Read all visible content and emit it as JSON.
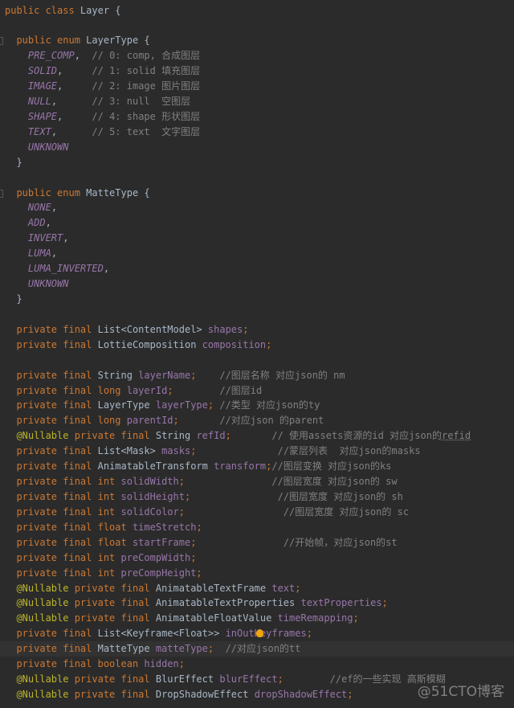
{
  "colors": {
    "background": "#2b2b2b",
    "keyword": "#cc7832",
    "type": "#a9b7c6",
    "field": "#9876aa",
    "comment": "#808080",
    "annotation": "#bbb529"
  },
  "current_line": 42,
  "lightbulb_line": 41,
  "watermark": "@51CTO博客",
  "lines": [
    [
      [
        "kw",
        "public class "
      ],
      [
        "type",
        "Layer {"
      ]
    ],
    [],
    [
      [
        "plain",
        "  "
      ],
      [
        "kw",
        "public enum "
      ],
      [
        "type",
        "LayerType {"
      ]
    ],
    [
      [
        "plain",
        "    "
      ],
      [
        "const",
        "PRE_COMP"
      ],
      [
        "plain",
        ",  "
      ],
      [
        "comment",
        "// 0: comp, 合成图层"
      ]
    ],
    [
      [
        "plain",
        "    "
      ],
      [
        "const",
        "SOLID"
      ],
      [
        "plain",
        ",     "
      ],
      [
        "comment",
        "// 1: solid 填充图层"
      ]
    ],
    [
      [
        "plain",
        "    "
      ],
      [
        "const",
        "IMAGE"
      ],
      [
        "plain",
        ",     "
      ],
      [
        "comment",
        "// 2: image 图片图层"
      ]
    ],
    [
      [
        "plain",
        "    "
      ],
      [
        "const",
        "NULL"
      ],
      [
        "plain",
        ",      "
      ],
      [
        "comment",
        "// 3: null  空图层"
      ]
    ],
    [
      [
        "plain",
        "    "
      ],
      [
        "const",
        "SHAPE"
      ],
      [
        "plain",
        ",     "
      ],
      [
        "comment",
        "// 4: shape 形状图层"
      ]
    ],
    [
      [
        "plain",
        "    "
      ],
      [
        "const",
        "TEXT"
      ],
      [
        "plain",
        ",      "
      ],
      [
        "comment",
        "// 5: text  文字图层"
      ]
    ],
    [
      [
        "plain",
        "    "
      ],
      [
        "const",
        "UNKNOWN"
      ]
    ],
    [
      [
        "plain",
        "  }"
      ]
    ],
    [],
    [
      [
        "plain",
        "  "
      ],
      [
        "kw",
        "public enum "
      ],
      [
        "type",
        "MatteType {"
      ]
    ],
    [
      [
        "plain",
        "    "
      ],
      [
        "const",
        "NONE"
      ],
      [
        "plain",
        ","
      ]
    ],
    [
      [
        "plain",
        "    "
      ],
      [
        "const",
        "ADD"
      ],
      [
        "plain",
        ","
      ]
    ],
    [
      [
        "plain",
        "    "
      ],
      [
        "const",
        "INVERT"
      ],
      [
        "plain",
        ","
      ]
    ],
    [
      [
        "plain",
        "    "
      ],
      [
        "const",
        "LUMA"
      ],
      [
        "plain",
        ","
      ]
    ],
    [
      [
        "plain",
        "    "
      ],
      [
        "const",
        "LUMA_INVERTED"
      ],
      [
        "plain",
        ","
      ]
    ],
    [
      [
        "plain",
        "    "
      ],
      [
        "const",
        "UNKNOWN"
      ]
    ],
    [
      [
        "plain",
        "  }"
      ]
    ],
    [],
    [
      [
        "plain",
        "  "
      ],
      [
        "kw",
        "private final "
      ],
      [
        "type",
        "List<ContentModel> "
      ],
      [
        "field",
        "shapes"
      ],
      [
        "kw",
        ";"
      ]
    ],
    [
      [
        "plain",
        "  "
      ],
      [
        "kw",
        "private final "
      ],
      [
        "type",
        "LottieComposition "
      ],
      [
        "field",
        "composition"
      ],
      [
        "kw",
        ";"
      ]
    ],
    [],
    [
      [
        "plain",
        "  "
      ],
      [
        "kw",
        "private final "
      ],
      [
        "type",
        "String "
      ],
      [
        "field",
        "layerName"
      ],
      [
        "kw",
        ";"
      ],
      [
        "plain",
        "    "
      ],
      [
        "comment",
        "//图层名称 对应json的 nm"
      ]
    ],
    [
      [
        "plain",
        "  "
      ],
      [
        "kw",
        "private final long "
      ],
      [
        "field",
        "layerId"
      ],
      [
        "kw",
        ";"
      ],
      [
        "plain",
        "        "
      ],
      [
        "comment",
        "//图层id"
      ]
    ],
    [
      [
        "plain",
        "  "
      ],
      [
        "kw",
        "private final "
      ],
      [
        "type",
        "LayerType "
      ],
      [
        "field",
        "layerType"
      ],
      [
        "kw",
        ";"
      ],
      [
        "plain",
        " "
      ],
      [
        "comment",
        "//类型 对应json的ty"
      ]
    ],
    [
      [
        "plain",
        "  "
      ],
      [
        "kw",
        "private final long "
      ],
      [
        "field",
        "parentId"
      ],
      [
        "kw",
        ";"
      ],
      [
        "plain",
        "       "
      ],
      [
        "comment",
        "//对应json 的parent"
      ]
    ],
    [
      [
        "plain",
        "  "
      ],
      [
        "ann",
        "@Nullable "
      ],
      [
        "kw",
        "private final "
      ],
      [
        "type",
        "String "
      ],
      [
        "field",
        "refId"
      ],
      [
        "kw",
        ";"
      ],
      [
        "plain",
        "       "
      ],
      [
        "comment",
        "// 使用assets资源的id 对应json的"
      ],
      [
        "comment typo",
        "refid"
      ]
    ],
    [
      [
        "plain",
        "  "
      ],
      [
        "kw",
        "private final "
      ],
      [
        "type",
        "List<Mask> "
      ],
      [
        "field",
        "masks"
      ],
      [
        "kw",
        ";"
      ],
      [
        "plain",
        "              "
      ],
      [
        "comment",
        "//蒙层列表  对应json的masks"
      ]
    ],
    [
      [
        "plain",
        "  "
      ],
      [
        "kw",
        "private final "
      ],
      [
        "type",
        "AnimatableTransform "
      ],
      [
        "field",
        "transform"
      ],
      [
        "kw",
        ";"
      ],
      [
        "comment",
        "//图层变换 对应json的ks"
      ]
    ],
    [
      [
        "plain",
        "  "
      ],
      [
        "kw",
        "private final int "
      ],
      [
        "field",
        "solidWidth"
      ],
      [
        "kw",
        ";"
      ],
      [
        "plain",
        "               "
      ],
      [
        "comment",
        "//图层宽度 对应json的 sw"
      ]
    ],
    [
      [
        "plain",
        "  "
      ],
      [
        "kw",
        "private final int "
      ],
      [
        "field",
        "solidHeight"
      ],
      [
        "kw",
        ";"
      ],
      [
        "plain",
        "               "
      ],
      [
        "comment",
        "//图层宽度 对应json的 sh"
      ]
    ],
    [
      [
        "plain",
        "  "
      ],
      [
        "kw",
        "private final int "
      ],
      [
        "field",
        "solidColor"
      ],
      [
        "kw",
        ";"
      ],
      [
        "plain",
        "                 "
      ],
      [
        "comment",
        "//图层宽度 对应json的 sc"
      ]
    ],
    [
      [
        "plain",
        "  "
      ],
      [
        "kw",
        "private final float "
      ],
      [
        "field",
        "timeStretch"
      ],
      [
        "kw",
        ";"
      ]
    ],
    [
      [
        "plain",
        "  "
      ],
      [
        "kw",
        "private final float "
      ],
      [
        "field",
        "startFrame"
      ],
      [
        "kw",
        ";"
      ],
      [
        "plain",
        "               "
      ],
      [
        "comment",
        "//开始帧，对应json的st"
      ]
    ],
    [
      [
        "plain",
        "  "
      ],
      [
        "kw",
        "private final int "
      ],
      [
        "field",
        "preCompWidth"
      ],
      [
        "kw",
        ";"
      ]
    ],
    [
      [
        "plain",
        "  "
      ],
      [
        "kw",
        "private final int "
      ],
      [
        "field",
        "preCompHeight"
      ],
      [
        "kw",
        ";"
      ]
    ],
    [
      [
        "plain",
        "  "
      ],
      [
        "ann",
        "@Nullable "
      ],
      [
        "kw",
        "private final "
      ],
      [
        "type",
        "AnimatableTextFrame "
      ],
      [
        "field",
        "text"
      ],
      [
        "kw",
        ";"
      ]
    ],
    [
      [
        "plain",
        "  "
      ],
      [
        "ann",
        "@Nullable "
      ],
      [
        "kw",
        "private final "
      ],
      [
        "type",
        "AnimatableTextProperties "
      ],
      [
        "field",
        "textProperties"
      ],
      [
        "kw",
        ";"
      ]
    ],
    [
      [
        "plain",
        "  "
      ],
      [
        "ann",
        "@Nullable "
      ],
      [
        "kw",
        "private final "
      ],
      [
        "type",
        "AnimatableFloatValue "
      ],
      [
        "field",
        "timeRemapping"
      ],
      [
        "kw",
        ";"
      ]
    ],
    [
      [
        "plain",
        "  "
      ],
      [
        "kw",
        "private final "
      ],
      [
        "type",
        "List<Keyframe<Float>> "
      ],
      [
        "field",
        "inOutK"
      ],
      [
        "bulb",
        ""
      ],
      [
        "field",
        "eyframes"
      ],
      [
        "kw",
        ";"
      ]
    ],
    [
      [
        "plain",
        "  "
      ],
      [
        "kw",
        "private final "
      ],
      [
        "type",
        "MatteType "
      ],
      [
        "field",
        "matteType"
      ],
      [
        "kw",
        ";"
      ],
      [
        "plain",
        "  "
      ],
      [
        "comment",
        "//对应json的tt"
      ]
    ],
    [
      [
        "plain",
        "  "
      ],
      [
        "kw",
        "private final boolean "
      ],
      [
        "field",
        "hidden"
      ],
      [
        "kw",
        ";"
      ]
    ],
    [
      [
        "plain",
        "  "
      ],
      [
        "ann",
        "@Nullable "
      ],
      [
        "kw",
        "private final "
      ],
      [
        "type",
        "BlurEffect "
      ],
      [
        "field",
        "blurEffect"
      ],
      [
        "kw",
        ";"
      ],
      [
        "plain",
        "        "
      ],
      [
        "comment",
        "//ef的一些实现 高斯模糊"
      ]
    ],
    [
      [
        "plain",
        "  "
      ],
      [
        "ann",
        "@Nullable "
      ],
      [
        "kw",
        "private final "
      ],
      [
        "type",
        "DropShadowEffect "
      ],
      [
        "field",
        "dropShadowEffect"
      ],
      [
        "kw",
        ";"
      ]
    ]
  ]
}
